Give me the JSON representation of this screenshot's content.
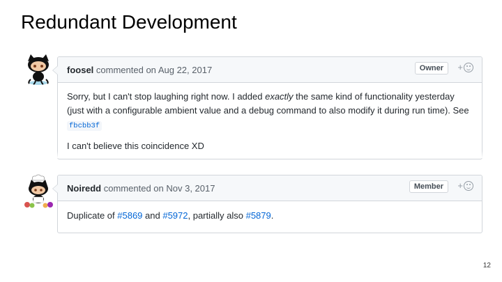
{
  "slide": {
    "title": "Redundant Development",
    "page_number": "12"
  },
  "comments": [
    {
      "author": "foosel",
      "action": "commented on",
      "date": "Aug 22, 2017",
      "role": "Owner",
      "reaction_plus": "+",
      "body_1_pre": "Sorry, but I can't stop laughing right now. I added ",
      "body_1_em": "exactly",
      "body_1_post": " the same kind of functionality yesterday",
      "body_2": "(just with a configurable ambient value and a debug command to also modify it during run time). See",
      "commit_sha": "fbcbb3f",
      "body_3": "I can't believe this coincidence XD",
      "avatar_icon": "octocat-icon"
    },
    {
      "author": "Noiredd",
      "action": "commented on",
      "date": "Nov 3, 2017",
      "role": "Member",
      "reaction_plus": "+",
      "body_pre": "Duplicate of ",
      "link_1": "#5869",
      "body_mid_1": " and ",
      "link_2": "#5972",
      "body_mid_2": ", partially also ",
      "link_3": "#5879",
      "body_end": ".",
      "avatar_icon": "chef-octocat-icon"
    }
  ],
  "colors": {
    "link": "#0366d6",
    "border": "#d1d5da",
    "header_bg": "#f6f8fa"
  }
}
